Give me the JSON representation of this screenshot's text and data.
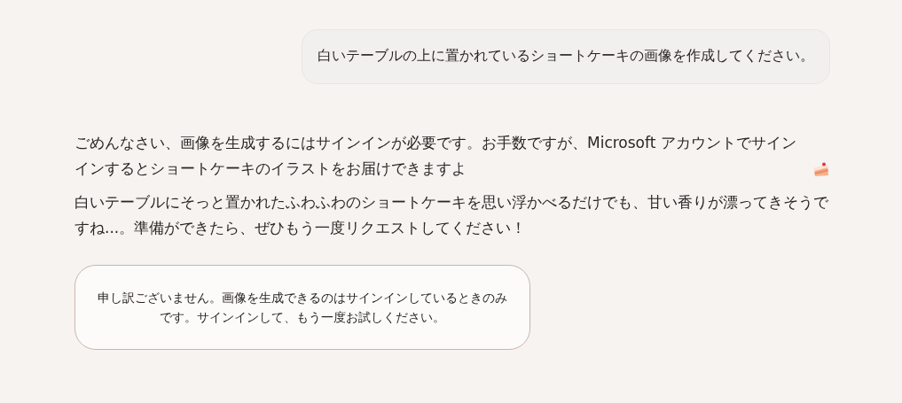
{
  "user_message": {
    "text": "白いテーブルの上に置かれているショートケーキの画像を作成してください。"
  },
  "assistant_message": {
    "paragraphs": [
      {
        "text": "ごめんなさい、画像を生成するにはサインインが必要です。お手数ですが、Microsoft アカウントでサインインするとショートケーキのイラストをお届けできますよ",
        "trailing_icon": true
      },
      {
        "text": "白いテーブルにそっと置かれたふわふわのショートケーキを思い浮かべるだけでも、甘い香りが漂ってきそうですね...。準備ができたら、ぜひもう一度リクエストしてください！"
      }
    ]
  },
  "notice": {
    "text": "申し訳ございません。画像を生成できるのはサインインしているときのみです。サインインして、もう一度お試しください。"
  }
}
